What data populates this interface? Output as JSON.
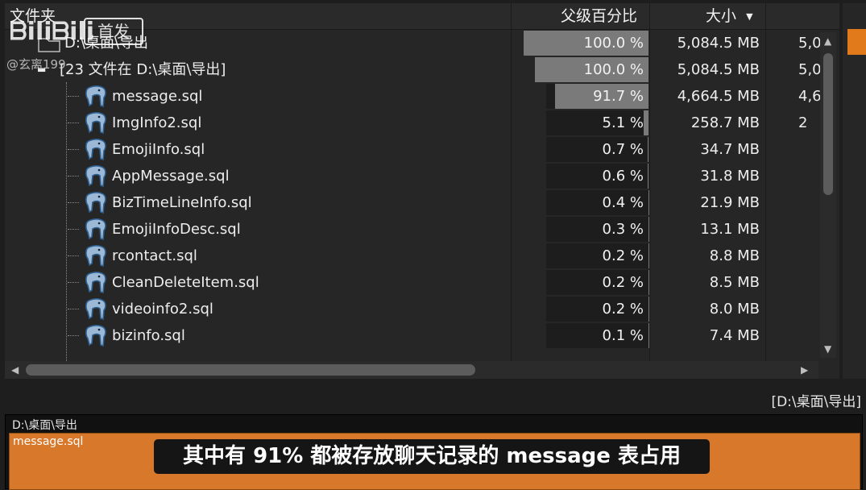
{
  "header": {
    "col_folder": "文件夹",
    "col_parent_pct": "父级百分比",
    "col_size": "大小",
    "sort_icon": "triangle-down-icon"
  },
  "tree": {
    "root": {
      "label": "D:\\桌面\\导出",
      "pct": "100.0 %",
      "pct_value": 100.0,
      "size": "5,084.5 MB",
      "extra": "5,0"
    },
    "files_node": {
      "label": "[23 文件在 D:\\桌面\\导出]",
      "pct": "100.0 %",
      "pct_value": 100.0,
      "size": "5,084.5 MB",
      "extra": "5,0"
    },
    "files": [
      {
        "name": "message.sql",
        "pct": "91.7 %",
        "pct_value": 91.7,
        "size": "4,664.5 MB",
        "extra": "4,6"
      },
      {
        "name": "ImgInfo2.sql",
        "pct": "5.1 %",
        "pct_value": 5.1,
        "size": "258.7 MB",
        "extra": "2"
      },
      {
        "name": "EmojiInfo.sql",
        "pct": "0.7 %",
        "pct_value": 0.7,
        "size": "34.7 MB",
        "extra": ""
      },
      {
        "name": "AppMessage.sql",
        "pct": "0.6 %",
        "pct_value": 0.6,
        "size": "31.8 MB",
        "extra": ""
      },
      {
        "name": "BizTimeLineInfo.sql",
        "pct": "0.4 %",
        "pct_value": 0.4,
        "size": "21.9 MB",
        "extra": ""
      },
      {
        "name": "EmojiInfoDesc.sql",
        "pct": "0.3 %",
        "pct_value": 0.3,
        "size": "13.1 MB",
        "extra": ""
      },
      {
        "name": "rcontact.sql",
        "pct": "0.2 %",
        "pct_value": 0.2,
        "size": "8.8 MB",
        "extra": ""
      },
      {
        "name": "CleanDeleteItem.sql",
        "pct": "0.2 %",
        "pct_value": 0.2,
        "size": "8.5 MB",
        "extra": ""
      },
      {
        "name": "videoinfo2.sql",
        "pct": "0.2 %",
        "pct_value": 0.2,
        "size": "8.0 MB",
        "extra": ""
      },
      {
        "name": "bizinfo.sql",
        "pct": "0.1 %",
        "pct_value": 0.1,
        "size": "7.4 MB",
        "extra": ""
      }
    ],
    "file_icon": "database-elephant-icon"
  },
  "status_path": "[D:\\桌面\\导出]",
  "bottom": {
    "title": "D:\\桌面\\导出",
    "block_label": "message.sql"
  },
  "subtitle": "其中有 91% 都被存放聊天记录的 message 表占用",
  "watermark": {
    "logo_text": "bilibili",
    "badge": "首发",
    "user": "@玄离199"
  },
  "colors": {
    "accent_orange": "#d7782a",
    "bar_fill": "#7a7a7a",
    "panel_bg": "#262626"
  }
}
